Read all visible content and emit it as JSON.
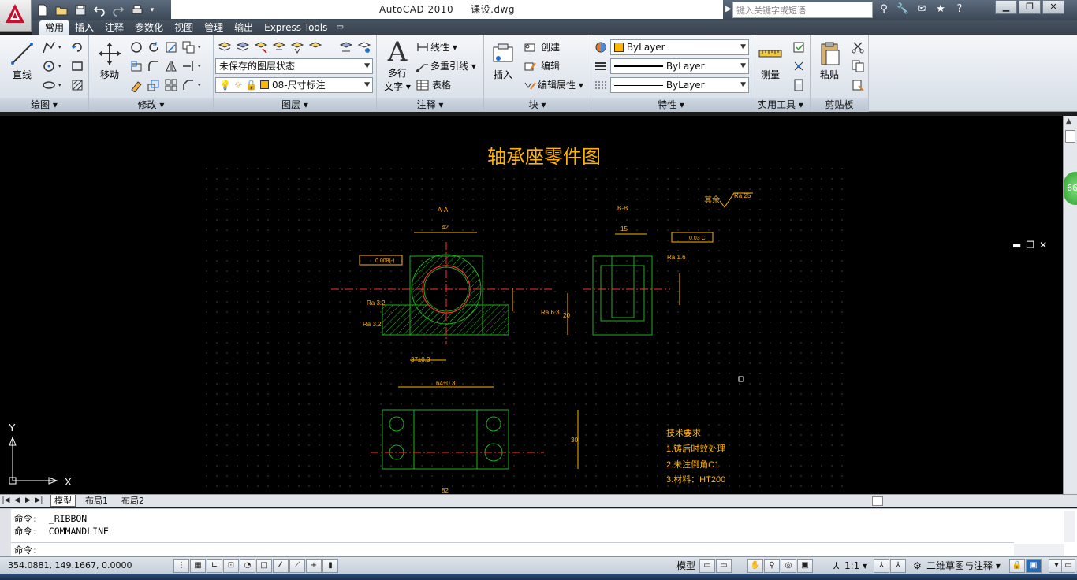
{
  "app": {
    "title_app": "AutoCAD 2010",
    "title_file": "课设.dwg",
    "search_placeholder": "键入关键字或短语"
  },
  "tabs": [
    "常用",
    "插入",
    "注释",
    "参数化",
    "视图",
    "管理",
    "输出",
    "Express Tools"
  ],
  "ribbon": {
    "draw": {
      "line_label": "直线",
      "panel_label": "绘图 ▾"
    },
    "modify": {
      "move_label": "移动",
      "panel_label": "修改 ▾"
    },
    "layers": {
      "layer_state": "未保存的图层状态",
      "current_layer": "08-尺寸标注",
      "panel_label": "图层 ▾"
    },
    "annotation": {
      "mtext_label": "多行\n文字",
      "mtext_line1": "多行",
      "mtext_line2": "文字 ▾",
      "linear_label": "线性 ▾",
      "mleader_label": "多重引线 ▾",
      "table_label": "表格",
      "panel_label": "注释 ▾"
    },
    "block": {
      "insert_label": "插入",
      "create_label": "创建",
      "edit_label": "编辑",
      "edit_attr_label": "编辑属性 ▾",
      "panel_label": "块 ▾"
    },
    "properties": {
      "color": "ByLayer",
      "linetype": "ByLayer",
      "lineweight": "ByLayer",
      "panel_label": "特性 ▾"
    },
    "utilities": {
      "measure_label": "测量",
      "panel_label": "实用工具 ▾"
    },
    "clipboard": {
      "paste_label": "粘贴",
      "panel_label": "剪贴板"
    }
  },
  "drawing": {
    "title": "轴承座零件图",
    "section_aa": "A-A",
    "section_bb": "B-B",
    "remaining_roughness": "其余",
    "ra25": "Ra 25",
    "dims": {
      "d42": "42",
      "d37": "37±0.3",
      "d64": "64±0.3",
      "d15": "15",
      "d20": "20",
      "d30": "30",
      "d82": "82",
      "tol003": "0.03 C",
      "tol0008": "0.008(-)",
      "ra32": "Ra 3.2",
      "ra63": "Ra 6.3",
      "ra16": "Ra 1.6"
    },
    "tech_req": {
      "heading": "技术要求",
      "r1": "1.铸后时效处理",
      "r2": "2.未注倒角C1",
      "r3": "3.材料：HT200"
    }
  },
  "ucs": {
    "x": "X",
    "y": "Y"
  },
  "layout_tabs": [
    "模型",
    "布局1",
    "布局2"
  ],
  "command": {
    "line1": "命令:  _RIBBON",
    "line2": "命令:  COMMANDLINE",
    "prompt": "命令:"
  },
  "status": {
    "coords": "354.0881, 149.1667, 0.0000",
    "model": "模型",
    "scale": "1:1 ▾",
    "workspace": "二维草图与注释 ▾"
  },
  "badge": "66"
}
